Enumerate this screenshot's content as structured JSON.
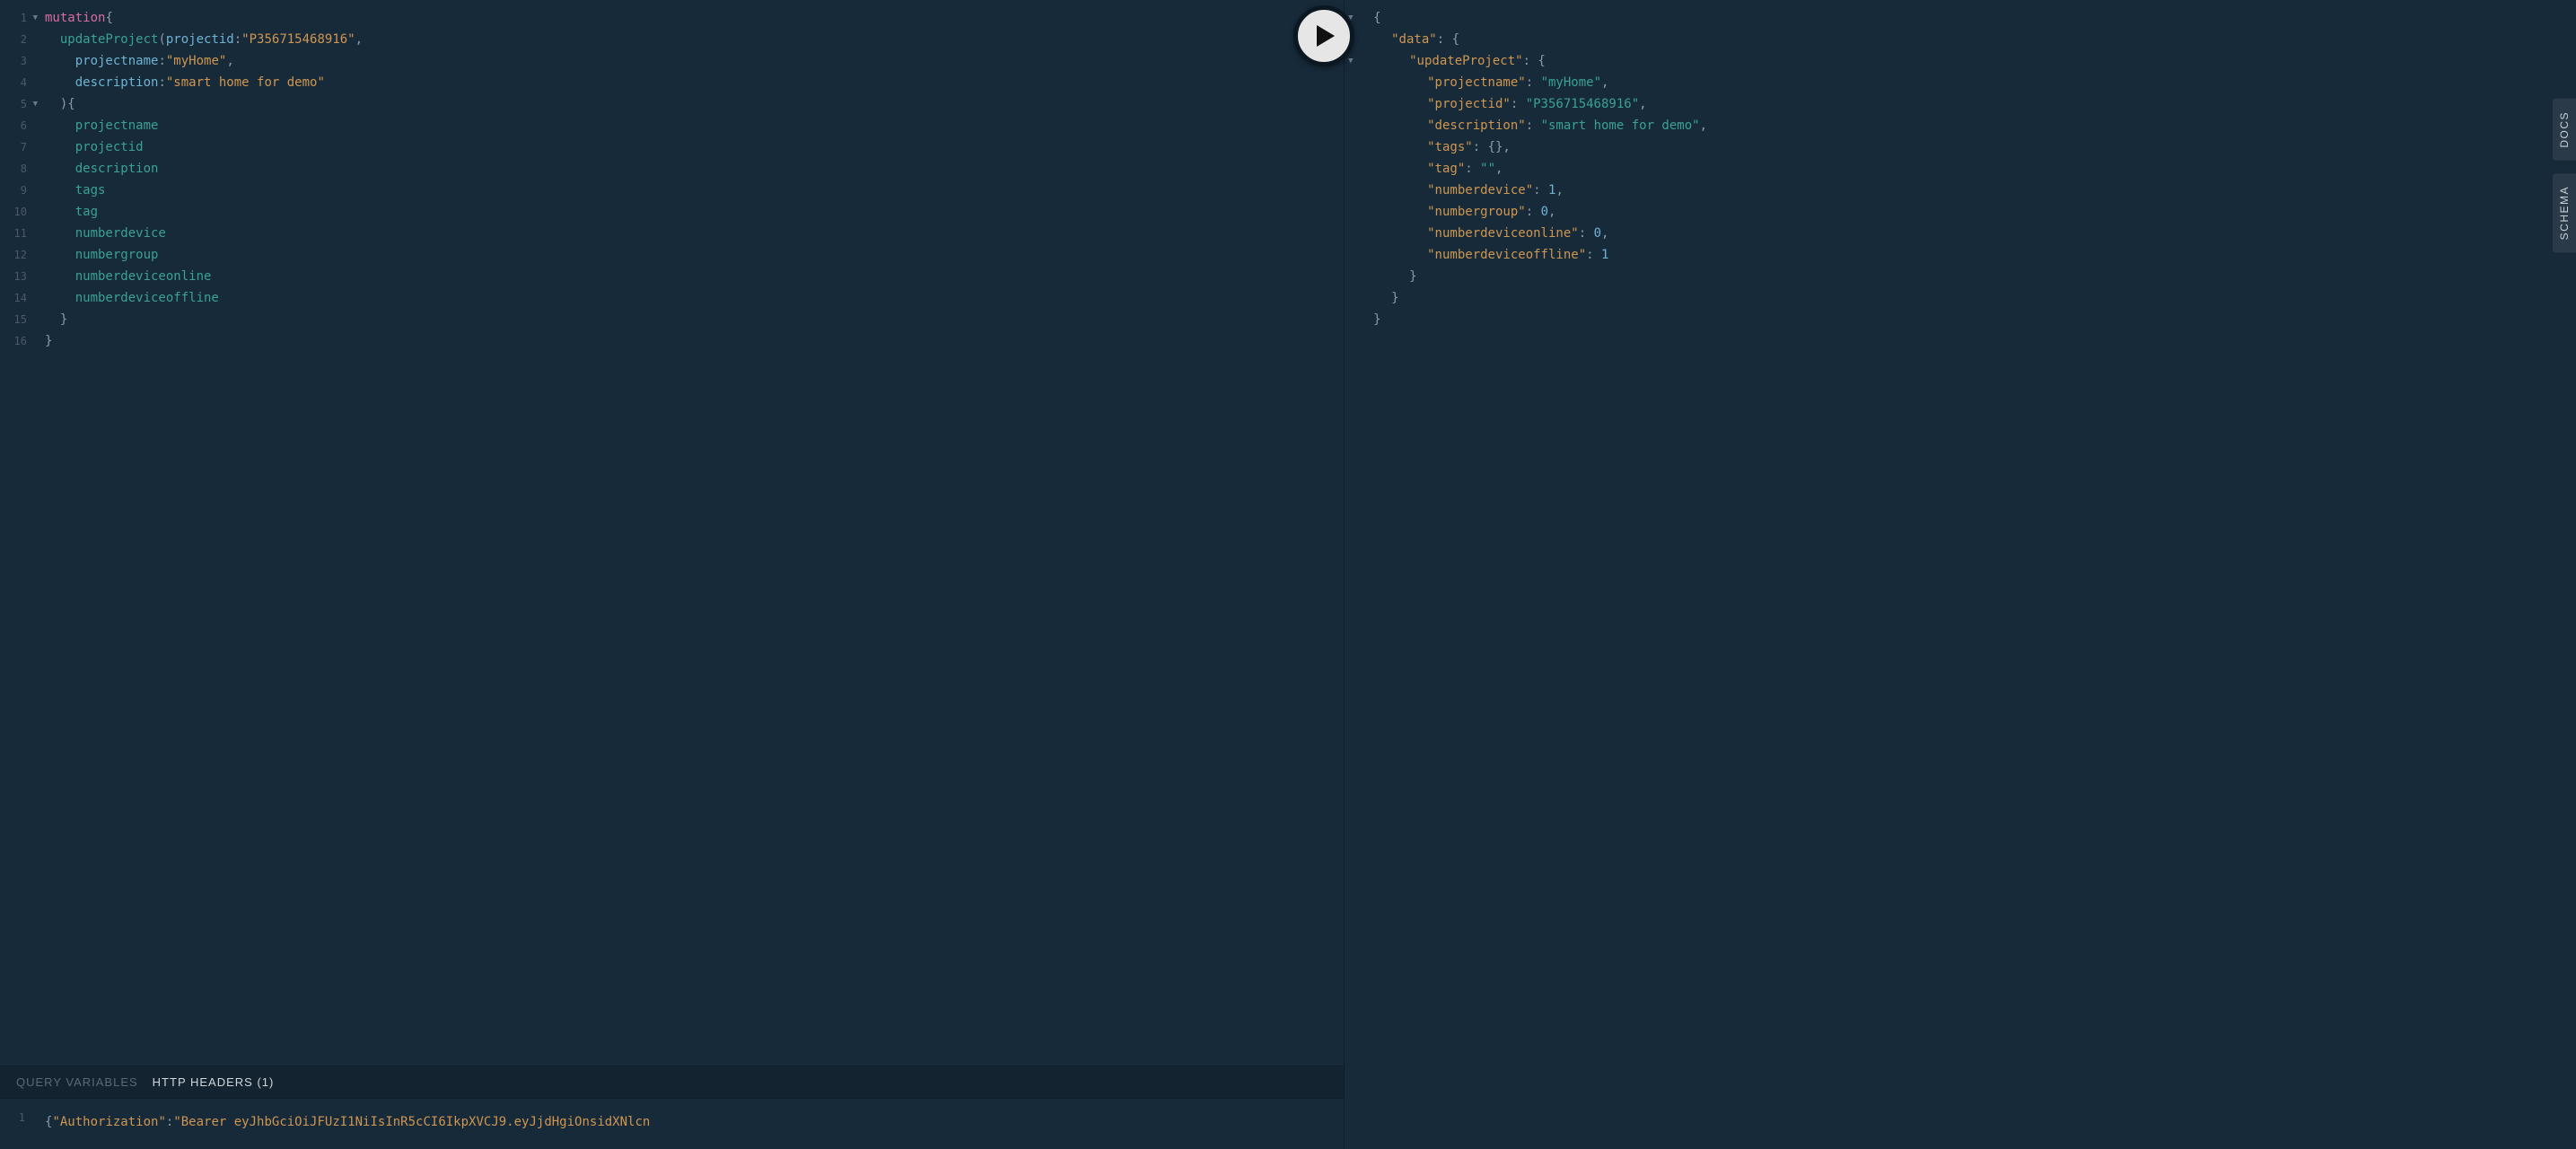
{
  "query": {
    "lines": [
      {
        "n": 1,
        "fold": true,
        "tokens": [
          {
            "t": "mutation",
            "c": "tk-keyword"
          },
          {
            "t": "{",
            "c": "tk-brace"
          }
        ]
      },
      {
        "n": 2,
        "tokens": [
          {
            "t": "  ",
            "c": ""
          },
          {
            "t": "updateProject",
            "c": "tk-field"
          },
          {
            "t": "(",
            "c": "tk-punct"
          },
          {
            "t": "projectid",
            "c": "tk-attr"
          },
          {
            "t": ":",
            "c": "tk-punct"
          },
          {
            "t": "\"P356715468916\"",
            "c": "tk-string"
          },
          {
            "t": ",",
            "c": "tk-punct"
          }
        ]
      },
      {
        "n": 3,
        "tokens": [
          {
            "t": "    ",
            "c": ""
          },
          {
            "t": "projectname",
            "c": "tk-attr"
          },
          {
            "t": ":",
            "c": "tk-punct"
          },
          {
            "t": "\"myHome\"",
            "c": "tk-string"
          },
          {
            "t": ",",
            "c": "tk-punct"
          }
        ]
      },
      {
        "n": 4,
        "tokens": [
          {
            "t": "    ",
            "c": ""
          },
          {
            "t": "description",
            "c": "tk-attr"
          },
          {
            "t": ":",
            "c": "tk-punct"
          },
          {
            "t": "\"smart home for demo\"",
            "c": "tk-string"
          }
        ]
      },
      {
        "n": 5,
        "fold": true,
        "tokens": [
          {
            "t": "  )",
            "c": "tk-punct"
          },
          {
            "t": "{",
            "c": "tk-brace"
          }
        ]
      },
      {
        "n": 6,
        "tokens": [
          {
            "t": "    ",
            "c": ""
          },
          {
            "t": "projectname",
            "c": "tk-field"
          }
        ]
      },
      {
        "n": 7,
        "tokens": [
          {
            "t": "    ",
            "c": ""
          },
          {
            "t": "projectid",
            "c": "tk-field"
          }
        ]
      },
      {
        "n": 8,
        "tokens": [
          {
            "t": "    ",
            "c": ""
          },
          {
            "t": "description",
            "c": "tk-field"
          }
        ]
      },
      {
        "n": 9,
        "tokens": [
          {
            "t": "    ",
            "c": ""
          },
          {
            "t": "tags",
            "c": "tk-field"
          }
        ]
      },
      {
        "n": 10,
        "tokens": [
          {
            "t": "    ",
            "c": ""
          },
          {
            "t": "tag",
            "c": "tk-field"
          }
        ]
      },
      {
        "n": 11,
        "tokens": [
          {
            "t": "    ",
            "c": ""
          },
          {
            "t": "numberdevice",
            "c": "tk-field"
          }
        ]
      },
      {
        "n": 12,
        "tokens": [
          {
            "t": "    ",
            "c": ""
          },
          {
            "t": "numbergroup",
            "c": "tk-field"
          }
        ]
      },
      {
        "n": 13,
        "tokens": [
          {
            "t": "    ",
            "c": ""
          },
          {
            "t": "numberdeviceonline",
            "c": "tk-field"
          }
        ]
      },
      {
        "n": 14,
        "tokens": [
          {
            "t": "    ",
            "c": ""
          },
          {
            "t": "numberdeviceoffline",
            "c": "tk-field"
          }
        ]
      },
      {
        "n": 15,
        "tokens": [
          {
            "t": "  ",
            "c": ""
          },
          {
            "t": "}",
            "c": "tk-brace"
          }
        ]
      },
      {
        "n": 16,
        "tokens": [
          {
            "t": "}",
            "c": "tk-brace"
          }
        ]
      }
    ]
  },
  "response": {
    "lines": [
      {
        "indent": 0,
        "fold": true,
        "tokens": [
          {
            "t": "{",
            "c": "jb"
          }
        ]
      },
      {
        "indent": 1,
        "fold": true,
        "tokens": [
          {
            "t": "\"data\"",
            "c": "jk"
          },
          {
            "t": ": ",
            "c": "jp"
          },
          {
            "t": "{",
            "c": "jb"
          }
        ]
      },
      {
        "indent": 2,
        "fold": true,
        "tokens": [
          {
            "t": "\"updateProject\"",
            "c": "jk"
          },
          {
            "t": ": ",
            "c": "jp"
          },
          {
            "t": "{",
            "c": "jb"
          }
        ]
      },
      {
        "indent": 3,
        "tokens": [
          {
            "t": "\"projectname\"",
            "c": "jk"
          },
          {
            "t": ": ",
            "c": "jp"
          },
          {
            "t": "\"myHome\"",
            "c": "js"
          },
          {
            "t": ",",
            "c": "jp"
          }
        ]
      },
      {
        "indent": 3,
        "tokens": [
          {
            "t": "\"projectid\"",
            "c": "jk"
          },
          {
            "t": ": ",
            "c": "jp"
          },
          {
            "t": "\"P356715468916\"",
            "c": "js"
          },
          {
            "t": ",",
            "c": "jp"
          }
        ]
      },
      {
        "indent": 3,
        "tokens": [
          {
            "t": "\"description\"",
            "c": "jk"
          },
          {
            "t": ": ",
            "c": "jp"
          },
          {
            "t": "\"smart home for demo\"",
            "c": "js"
          },
          {
            "t": ",",
            "c": "jp"
          }
        ]
      },
      {
        "indent": 3,
        "tokens": [
          {
            "t": "\"tags\"",
            "c": "jk"
          },
          {
            "t": ": ",
            "c": "jp"
          },
          {
            "t": "{}",
            "c": "jb"
          },
          {
            "t": ",",
            "c": "jp"
          }
        ]
      },
      {
        "indent": 3,
        "tokens": [
          {
            "t": "\"tag\"",
            "c": "jk"
          },
          {
            "t": ": ",
            "c": "jp"
          },
          {
            "t": "\"\"",
            "c": "js"
          },
          {
            "t": ",",
            "c": "jp"
          }
        ]
      },
      {
        "indent": 3,
        "tokens": [
          {
            "t": "\"numberdevice\"",
            "c": "jk"
          },
          {
            "t": ": ",
            "c": "jp"
          },
          {
            "t": "1",
            "c": "jn"
          },
          {
            "t": ",",
            "c": "jp"
          }
        ]
      },
      {
        "indent": 3,
        "tokens": [
          {
            "t": "\"numbergroup\"",
            "c": "jk"
          },
          {
            "t": ": ",
            "c": "jp"
          },
          {
            "t": "0",
            "c": "jn"
          },
          {
            "t": ",",
            "c": "jp"
          }
        ]
      },
      {
        "indent": 3,
        "tokens": [
          {
            "t": "\"numberdeviceonline\"",
            "c": "jk"
          },
          {
            "t": ": ",
            "c": "jp"
          },
          {
            "t": "0",
            "c": "jn"
          },
          {
            "t": ",",
            "c": "jp"
          }
        ]
      },
      {
        "indent": 3,
        "tokens": [
          {
            "t": "\"numberdeviceoffline\"",
            "c": "jk"
          },
          {
            "t": ": ",
            "c": "jp"
          },
          {
            "t": "1",
            "c": "jn"
          }
        ]
      },
      {
        "indent": 2,
        "tokens": [
          {
            "t": "}",
            "c": "jb"
          }
        ]
      },
      {
        "indent": 1,
        "tokens": [
          {
            "t": "}",
            "c": "jb"
          }
        ]
      },
      {
        "indent": 0,
        "tokens": [
          {
            "t": "}",
            "c": "jb"
          }
        ]
      }
    ]
  },
  "tabs": {
    "variables": "QUERY VARIABLES",
    "headers": "HTTP HEADERS (1)"
  },
  "headers_editor": {
    "line_no": "1",
    "tokens": [
      {
        "t": "{",
        "c": "tk-brace"
      },
      {
        "t": "\"Authorization\"",
        "c": "tk-string"
      },
      {
        "t": ":",
        "c": "tk-punct"
      },
      {
        "t": "\"Bearer eyJhbGciOiJFUzI1NiIsInR5cCI6IkpXVCJ9.eyJjdHgiOnsidXNlcn",
        "c": "tk-string"
      }
    ]
  },
  "side": {
    "docs": "DOCS",
    "schema": "SCHEMA"
  }
}
